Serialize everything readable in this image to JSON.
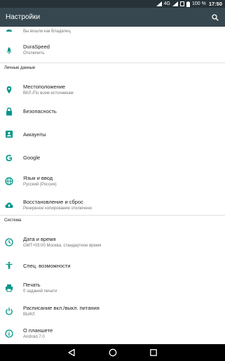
{
  "status_bar": {
    "network_label": "4G",
    "battery_percent": "100 %",
    "time": "17:50"
  },
  "header": {
    "title": "Настройки",
    "search_icon": "search-icon"
  },
  "colors": {
    "accent": "#009688",
    "app_bar": "#37474f",
    "status_bar": "#263238"
  },
  "items_top": [
    {
      "subtitle": "Вы вошли как Владелец",
      "icon": "user-icon"
    },
    {
      "title": "DuraSpeed",
      "subtitle": "Отключить",
      "icon": "rocket-icon"
    }
  ],
  "sections": [
    {
      "header": "Личные данные",
      "items": [
        {
          "title": "Местоположение",
          "subtitle": "ВКЛ./По всем источникам",
          "icon": "location-icon"
        },
        {
          "title": "Безопасность",
          "subtitle": "",
          "icon": "lock-icon"
        },
        {
          "title": "Аккаунты",
          "subtitle": "",
          "icon": "account-icon"
        },
        {
          "title": "Google",
          "subtitle": "",
          "icon": "google-icon"
        },
        {
          "title": "Язык и ввод",
          "subtitle": "Русский (Россия)",
          "icon": "globe-icon"
        },
        {
          "title": "Восстановление и сброс",
          "subtitle": "Резервное копирование отключено",
          "icon": "cloud-upload-icon"
        }
      ]
    },
    {
      "header": "Система",
      "items": [
        {
          "title": "Дата и время",
          "subtitle": "GMT+03:00 Москва, стандартное время",
          "icon": "clock-icon"
        },
        {
          "title": "Спец. возможности",
          "subtitle": "",
          "icon": "accessibility-icon"
        },
        {
          "title": "Печать",
          "subtitle": "0 заданий печати",
          "icon": "printer-icon"
        },
        {
          "title": "Расписание вкл./выкл. питания",
          "subtitle": "ВЫКЛ",
          "icon": "power-icon"
        },
        {
          "title": "О планшете",
          "subtitle": "Android 7.0",
          "icon": "info-icon"
        }
      ]
    }
  ],
  "nav_bar": {
    "back_icon": "back-icon",
    "home_icon": "home-icon",
    "recents_icon": "recents-icon"
  }
}
